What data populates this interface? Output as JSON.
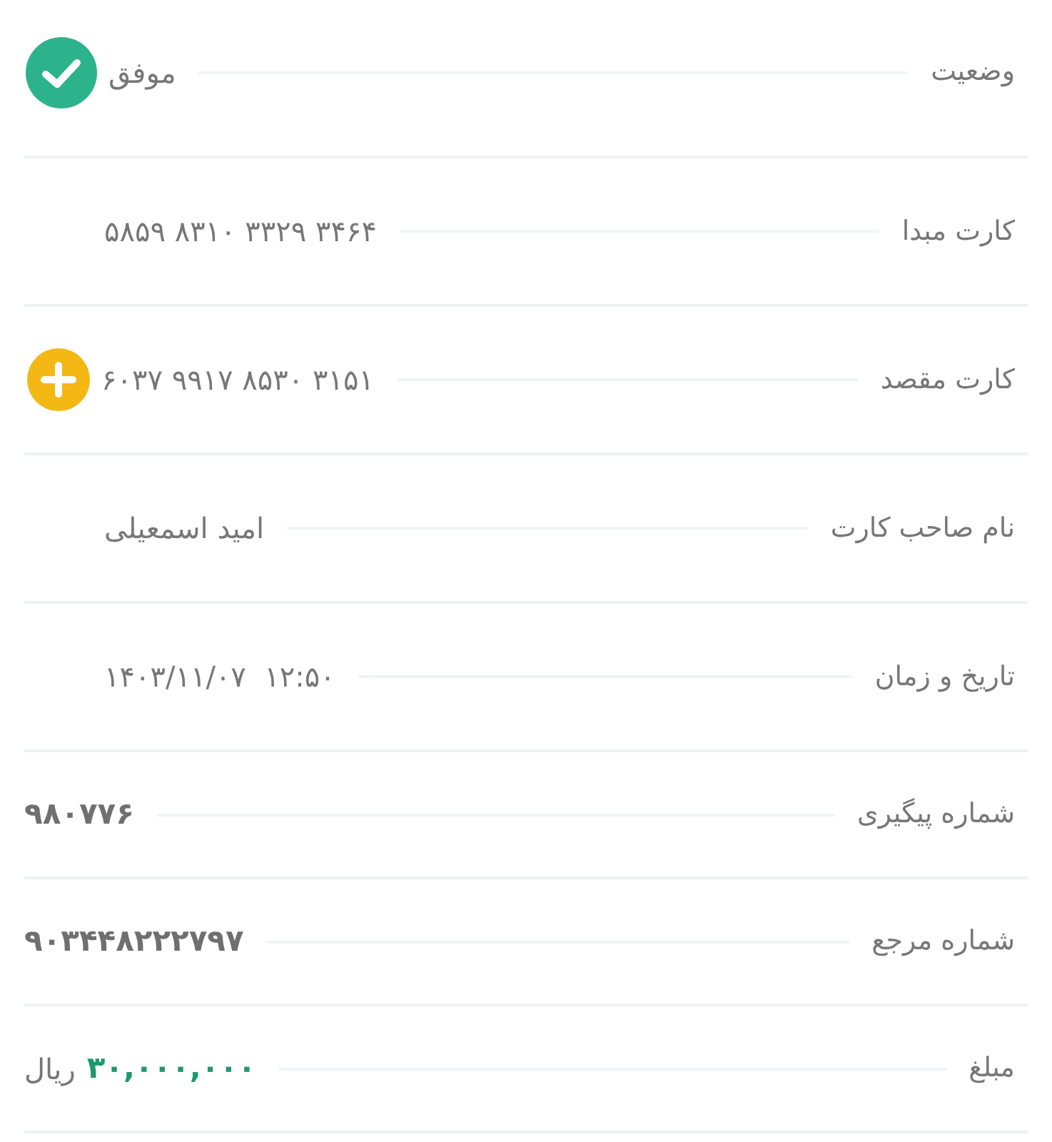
{
  "rows": [
    {
      "kind": "status",
      "label": "وضعیت",
      "value": "موفق"
    },
    {
      "kind": "card",
      "label": "کارت مبدا",
      "value": "۵۸۵۹ ۸۳۱۰ ۳۳۲۹ ۳۴۶۴"
    },
    {
      "kind": "card_add",
      "label": "کارت مقصد",
      "value": "۶۰۳۷ ۹۹۱۷ ۸۵۳۰ ۳۱۵۱"
    },
    {
      "kind": "plain",
      "label": "نام صاحب کارت",
      "value": "امید اسمعیلی"
    },
    {
      "kind": "card",
      "label": "تاریخ و زمان",
      "value": "۱۴۰۳/۱۱/۰۷  ۱۲:۵۰"
    },
    {
      "kind": "bold",
      "label": "شماره پیگیری",
      "value": "۹۸۰۷۷۶"
    },
    {
      "kind": "bold",
      "label": "شماره مرجع",
      "value": "۹۰۳۴۴۸۲۲۲۷۹۷"
    },
    {
      "kind": "amount",
      "label": "مبلغ",
      "value": "۳۰,۰۰۰,۰۰۰",
      "unit": "ریال"
    }
  ]
}
